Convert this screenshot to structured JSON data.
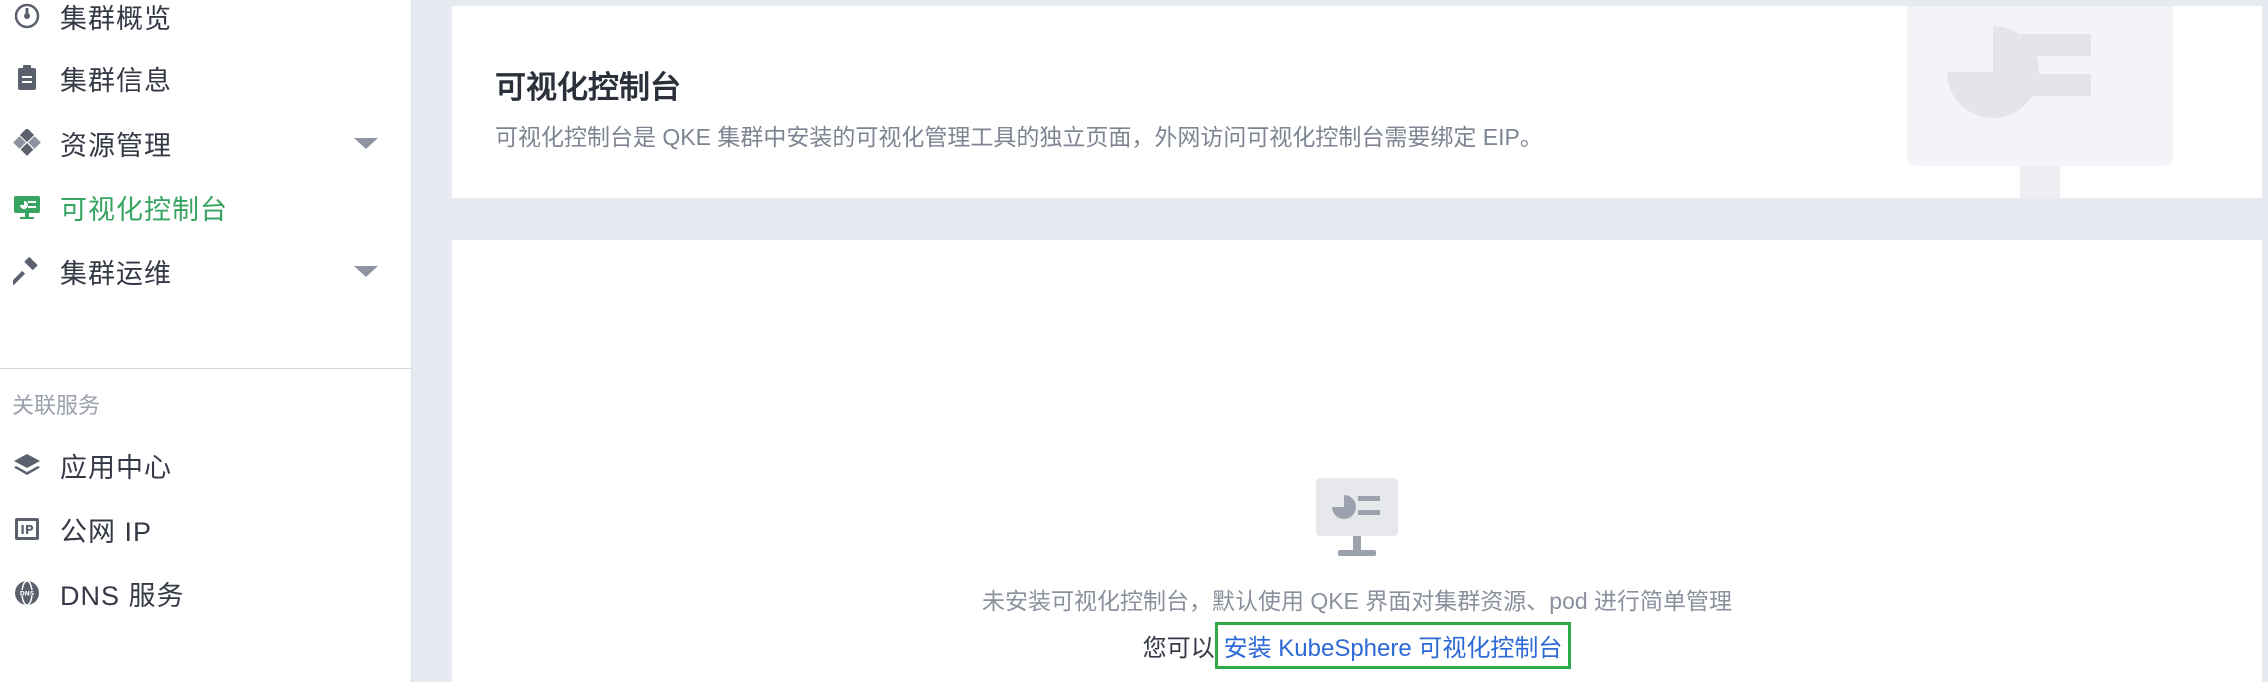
{
  "sidebar": {
    "items": [
      {
        "label": "集群概览",
        "icon": "dashboard-icon"
      },
      {
        "label": "集群信息",
        "icon": "clipboard-icon"
      },
      {
        "label": "资源管理",
        "icon": "resources-icon",
        "expandable": true
      },
      {
        "label": "可视化控制台",
        "icon": "console-icon",
        "active": true
      },
      {
        "label": "集群运维",
        "icon": "hammer-icon",
        "expandable": true
      }
    ],
    "related_title": "关联服务",
    "related_items": [
      {
        "label": "应用中心",
        "icon": "layers-icon"
      },
      {
        "label": "公网 IP",
        "icon": "ip-icon"
      },
      {
        "label": "DNS 服务",
        "icon": "dns-icon"
      }
    ]
  },
  "header": {
    "title": "可视化控制台",
    "description": "可视化控制台是 QKE 集群中安装的可视化管理工具的独立页面，外网访问可视化控制台需要绑定 EIP。"
  },
  "empty_state": {
    "message": "未安装可视化控制台，默认使用 QKE 界面对集群资源、pod 进行简单管理",
    "install_prefix": "您可以",
    "install_link": "安装 KubeSphere 可视化控制台"
  },
  "colors": {
    "accent_green": "#37a462",
    "link_blue": "#2d6ad6",
    "highlight_border": "#2fa94a"
  }
}
